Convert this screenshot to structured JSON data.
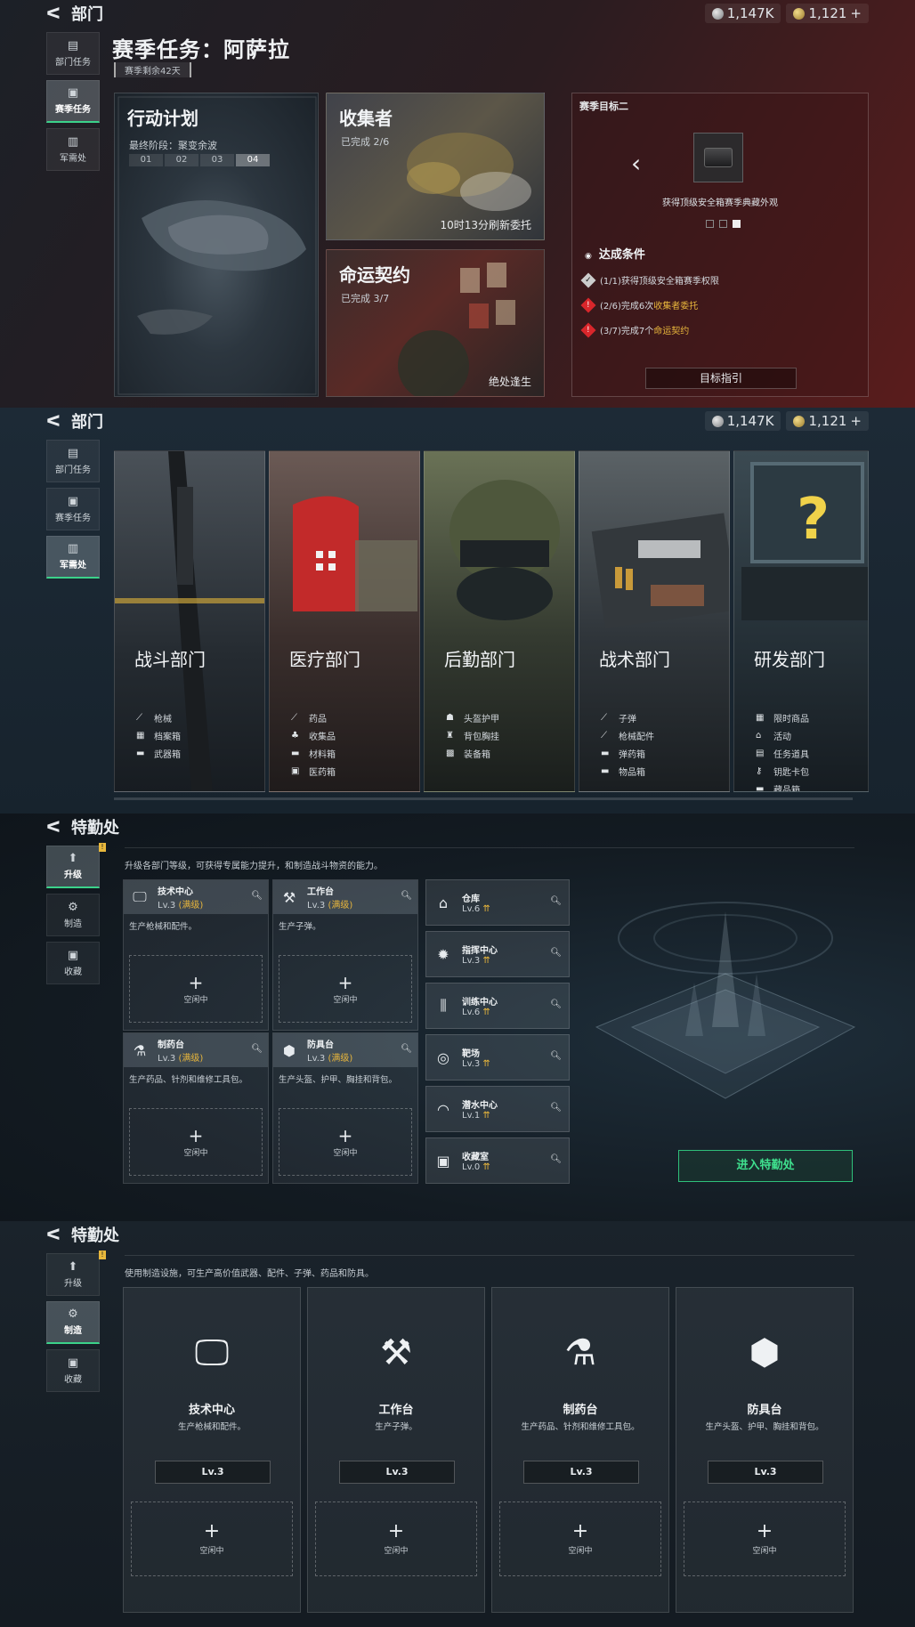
{
  "currency": {
    "silver": "1,147K",
    "gold": "1,121",
    "plus": "+"
  },
  "section1": {
    "header": "部门",
    "nav": [
      {
        "label": "部门任务"
      },
      {
        "label": "赛季任务"
      },
      {
        "label": "军需处"
      }
    ],
    "title": "赛季任务：阿萨拉",
    "subtitle": "赛季剩余42天",
    "plan": {
      "title": "行动计划",
      "stage": "最终阶段：聚变余波",
      "steps": [
        "01",
        "02",
        "03",
        "04"
      ]
    },
    "collector": {
      "title": "收集者",
      "progress": "已完成 2/6",
      "refresh": "10时13分刷新委托"
    },
    "contract": {
      "title": "命运契约",
      "progress": "已完成 3/7",
      "footer": "绝处逢生"
    },
    "goal": {
      "title": "赛季目标二",
      "caption": "获得顶级安全箱赛季典藏外观",
      "cond_header": "达成条件",
      "conditions": [
        {
          "prefix": "(1/1)获得顶级安全箱赛季权限",
          "highlight": "",
          "status": "done"
        },
        {
          "prefix": "(2/6)完成6次",
          "highlight": "收集者委托",
          "status": "todo"
        },
        {
          "prefix": "(3/7)完成7个",
          "highlight": "命运契约",
          "status": "todo"
        }
      ],
      "button": "目标指引"
    }
  },
  "section2": {
    "header": "部门",
    "nav": [
      {
        "label": "部门任务"
      },
      {
        "label": "赛季任务"
      },
      {
        "label": "军需处"
      }
    ],
    "departments": [
      {
        "name": "战斗部门",
        "items": [
          "枪械",
          "档案箱",
          "武器箱"
        ]
      },
      {
        "name": "医疗部门",
        "items": [
          "药品",
          "收集品",
          "材料箱",
          "医药箱"
        ]
      },
      {
        "name": "后勤部门",
        "items": [
          "头盔护甲",
          "背包胸挂",
          "装备箱"
        ]
      },
      {
        "name": "战术部门",
        "items": [
          "子弹",
          "枪械配件",
          "弹药箱",
          "物品箱"
        ]
      },
      {
        "name": "研发部门",
        "items": [
          "限时商品",
          "活动",
          "任务道具",
          "钥匙卡包",
          "藏品箱"
        ]
      }
    ]
  },
  "section3": {
    "header": "特勤处",
    "nav": [
      {
        "label": "升级"
      },
      {
        "label": "制造"
      },
      {
        "label": "收藏"
      }
    ],
    "badge": "!",
    "desc": "升级各部门等级，可获得专属能力提升，和制造战斗物资的能力。",
    "facilities": [
      {
        "name": "技术中心",
        "level": "Lv.3",
        "max": "(满级)",
        "desc": "生产枪械和配件。",
        "idle": "空闲中"
      },
      {
        "name": "工作台",
        "level": "Lv.3",
        "max": "(满级)",
        "desc": "生产子弹。",
        "idle": "空闲中"
      },
      {
        "name": "制药台",
        "level": "Lv.3",
        "max": "(满级)",
        "desc": "生产药品、针剂和维修工具包。",
        "idle": "空闲中"
      },
      {
        "name": "防具台",
        "level": "Lv.3",
        "max": "(满级)",
        "desc": "生产头盔、护甲、胸挂和背包。",
        "idle": "空闲中"
      }
    ],
    "rooms": [
      {
        "name": "仓库",
        "level": "Lv.6"
      },
      {
        "name": "指挥中心",
        "level": "Lv.3"
      },
      {
        "name": "训练中心",
        "level": "Lv.6"
      },
      {
        "name": "靶场",
        "level": "Lv.3"
      },
      {
        "name": "潜水中心",
        "level": "Lv.1"
      },
      {
        "name": "收藏室",
        "level": "Lv.0"
      }
    ],
    "up_icon": "⇈",
    "plus": "+",
    "enter": "进入特勤处"
  },
  "section4": {
    "header": "特勤处",
    "nav": [
      {
        "label": "升级"
      },
      {
        "label": "制造"
      },
      {
        "label": "收藏"
      }
    ],
    "badge": "!",
    "desc": "使用制造设施，可生产高价值武器、配件、子弹、药品和防具。",
    "plus": "+",
    "stations": [
      {
        "name": "技术中心",
        "desc": "生产枪械和配件。",
        "level": "Lv.3",
        "idle": "空闲中"
      },
      {
        "name": "工作台",
        "desc": "生产子弹。",
        "level": "Lv.3",
        "idle": "空闲中"
      },
      {
        "name": "制药台",
        "desc": "生产药品、针剂和维修工具包。",
        "level": "Lv.3",
        "idle": "空闲中"
      },
      {
        "name": "防具台",
        "desc": "生产头盔、护甲、胸挂和背包。",
        "level": "Lv.3",
        "idle": "空闲中"
      }
    ]
  }
}
